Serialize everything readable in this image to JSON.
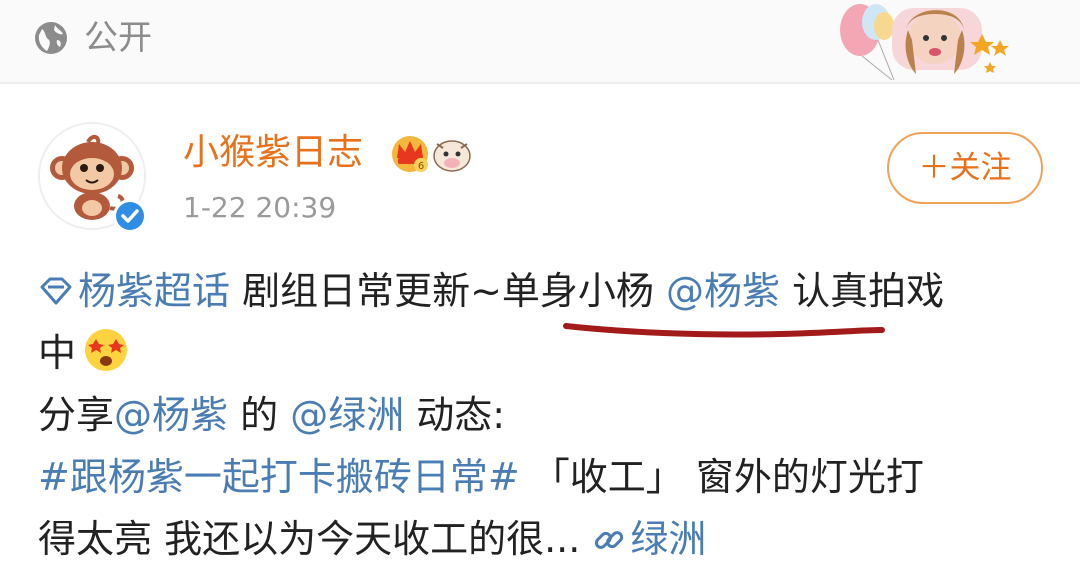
{
  "topbar": {
    "visibility_icon": "globe-icon",
    "visibility_label": "公开"
  },
  "post": {
    "author": "小猴紫日志",
    "timestamp": "1-22 20:39",
    "follow_label": "＋关注",
    "badges": [
      "crown-badge",
      "cow-badge"
    ],
    "verified": true,
    "lines": {
      "l1_topic": "杨紫超话",
      "l1_text": " 剧组日常更新~单身小杨 ",
      "l1_mention": "@杨紫",
      "l1_tail": " 认真拍戏",
      "l2_text": "中",
      "l3_prefix": "分享",
      "l3_mention1": "@杨紫",
      "l3_mid": " 的 ",
      "l3_mention2": "@绿洲",
      "l3_tail": " 动态:",
      "l4_hashtag": "#跟杨紫一起打卡搬砖日常#",
      "l4_tail": " 「收工」 窗外的灯光打",
      "l5_text": "得太亮 我还以为今天收工的很... ",
      "l5_link": "绿洲"
    }
  },
  "colors": {
    "accent": "#e8711c",
    "link": "#4a7db3",
    "underline_mark": "#a31a1a"
  }
}
